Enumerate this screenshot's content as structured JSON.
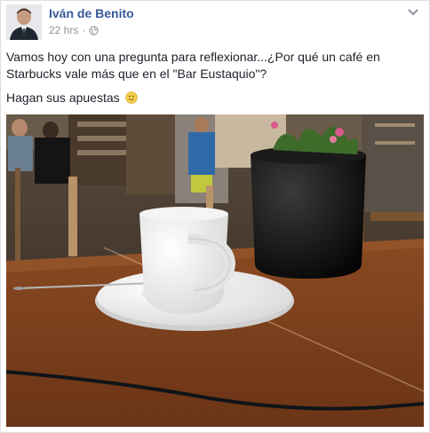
{
  "post": {
    "author_name": "Iván de Benito",
    "timestamp": "22 hrs",
    "separator": "·",
    "privacy_icon": "globe-icon",
    "menu_icon": "chevron-down-icon",
    "text_line_1": "Vamos hoy con una pregunta para reflexionar...¿Por qué un café en Starbucks vale más que en el \"Bar Eustaquio\"?",
    "text_line_2": "Hagan sus apuestas",
    "emoji_icon": "smile-emoji-icon"
  },
  "colors": {
    "author_link": "#365899",
    "meta_text": "#90949c",
    "body_text": "#1d2129",
    "card_border": "#dddfe2"
  }
}
